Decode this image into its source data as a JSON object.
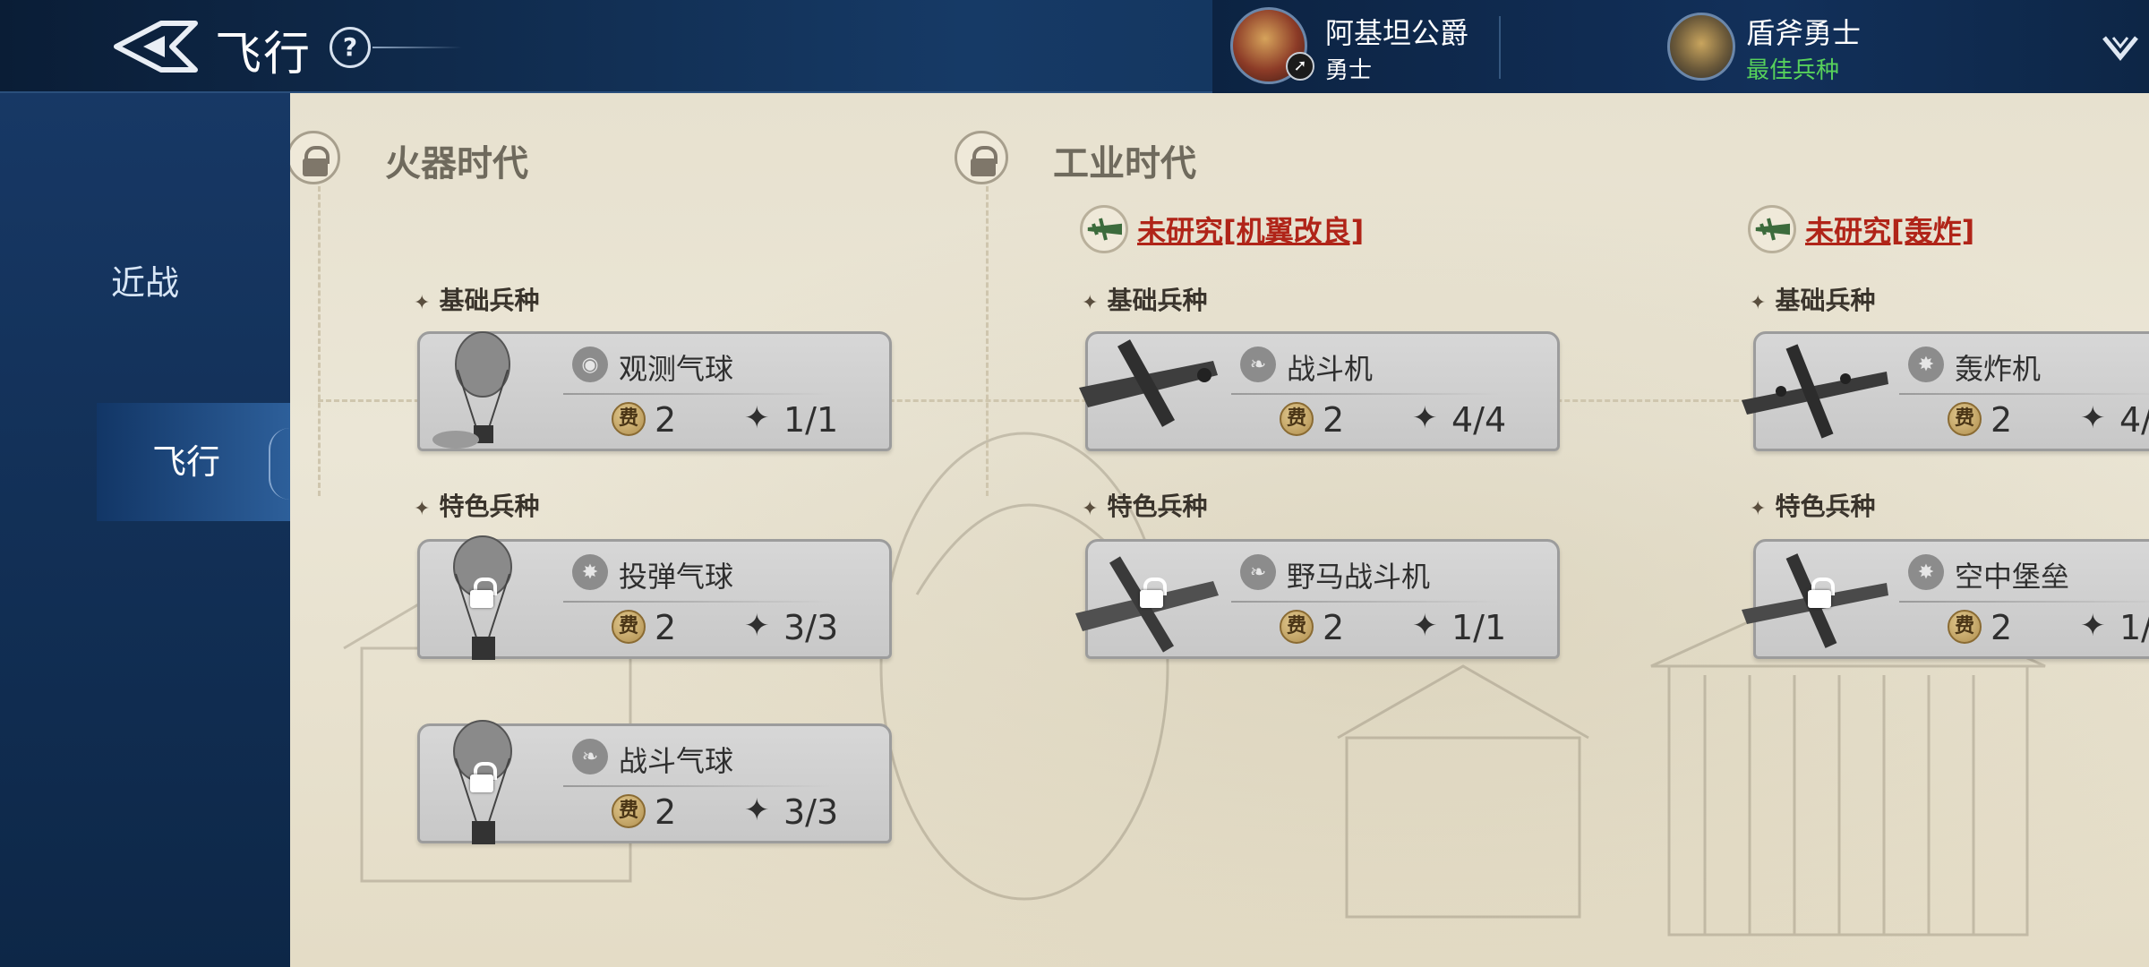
{
  "header": {
    "title": "飞行",
    "help_label": "?",
    "hero": {
      "name": "阿基坦公爵",
      "role": "勇士"
    },
    "unit": {
      "name": "盾斧勇士",
      "tag": "最佳兵种"
    }
  },
  "sidebar": {
    "tabs": [
      {
        "label": "近战",
        "selected": false
      },
      {
        "label": "飞行",
        "selected": true
      }
    ]
  },
  "eras": [
    {
      "title": "火器时代",
      "locked": true
    },
    {
      "title": "工业时代",
      "locked": true
    }
  ],
  "research": [
    {
      "text": "未研究[机翼改良]"
    },
    {
      "text": "未研究[轰炸]"
    }
  ],
  "labels": {
    "basic": "基础兵种",
    "special": "特色兵种",
    "star_glyph": "✦"
  },
  "cards": [
    {
      "name": "观测气球",
      "cost_icon": "费",
      "cost": "2",
      "count": "1/1",
      "icon": "eye-icon",
      "locked": false
    },
    {
      "name": "投弹气球",
      "cost_icon": "费",
      "cost": "2",
      "count": "3/3",
      "icon": "explosion-icon",
      "locked": true
    },
    {
      "name": "战斗气球",
      "cost_icon": "费",
      "cost": "2",
      "count": "3/3",
      "icon": "wing-icon",
      "locked": true
    },
    {
      "name": "战斗机",
      "cost_icon": "费",
      "cost": "2",
      "count": "4/4",
      "icon": "wing-icon",
      "locked": false
    },
    {
      "name": "野马战斗机",
      "cost_icon": "费",
      "cost": "2",
      "count": "1/1",
      "icon": "wing-icon",
      "locked": true
    },
    {
      "name": "轰炸机",
      "cost_icon": "费",
      "cost": "2",
      "count": "4/",
      "icon": "explosion-icon",
      "locked": false
    },
    {
      "name": "空中堡垒",
      "cost_icon": "费",
      "cost": "2",
      "count": "1/",
      "icon": "explosion-icon",
      "locked": true
    }
  ],
  "colors": {
    "accent_red": "#b02418",
    "best_unit_green": "#57d15b",
    "nav_blue": "#163a66"
  }
}
